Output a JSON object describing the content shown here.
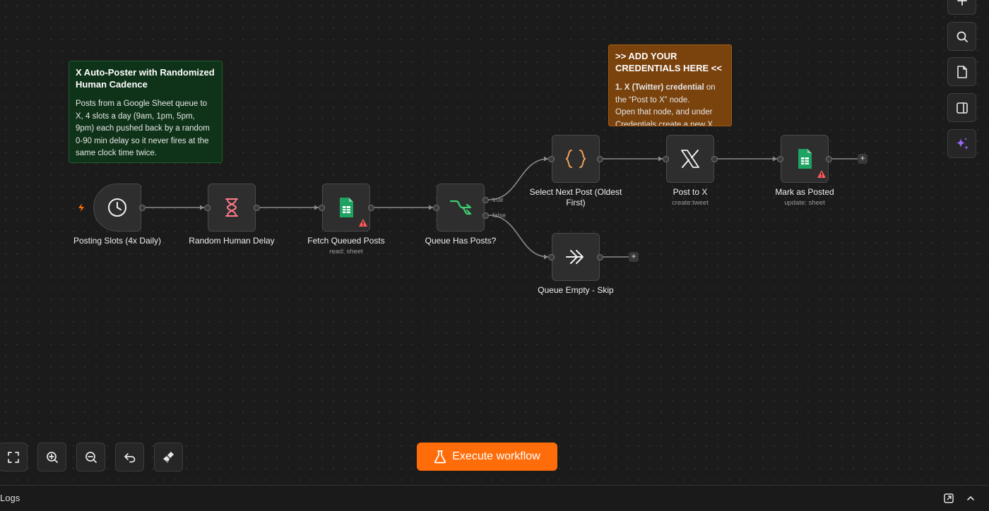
{
  "sticky_notes": {
    "intro": {
      "title": "X Auto-Poster with Randomized Human Cadence",
      "text": "Posts from a Google Sheet queue to X, 4 slots a day (9am, 1pm, 5pm, 9pm) each pushed back by a random 0-90 min delay so it never fires at the same clock time twice."
    },
    "credentials": {
      "title": ">> ADD YOUR CREDENTIALS HERE <<",
      "bold": "1. X (Twitter) credential",
      "text1": " on the “Post to X” node.",
      "text2": "Open that node, and under Credentials create a new X"
    }
  },
  "nodes": [
    {
      "label": "Posting Slots (4x Daily)",
      "icon": "clock-icon"
    },
    {
      "label": "Random Human Delay",
      "icon": "hourglass-icon"
    },
    {
      "label": "Fetch Queued Posts",
      "sub": "read: sheet",
      "icon": "google-sheets-icon"
    },
    {
      "label": "Queue Has Posts?",
      "icon": "if-branch-icon"
    },
    {
      "label": "Select Next Post (Oldest First)",
      "icon": "code-braces-icon"
    },
    {
      "label": "Post to X",
      "sub": "create:tweet",
      "icon": "x-logo-icon"
    },
    {
      "label": "Mark as Posted",
      "sub": "update: sheet",
      "icon": "google-sheets-icon"
    },
    {
      "label": "Queue Empty - Skip",
      "icon": "no-op-arrow-icon"
    }
  ],
  "branches": {
    "true_label": "true",
    "false_label": "false"
  },
  "toolbar": {
    "execute_label": "Execute workflow"
  },
  "logs": {
    "label": "Logs"
  },
  "colors": {
    "accent": "#ff6d0a",
    "sheets_green": "#1ea362",
    "warning": "#ff5a5a",
    "if_green": "#3ccf6e",
    "code_orange": "#f0a35a"
  }
}
